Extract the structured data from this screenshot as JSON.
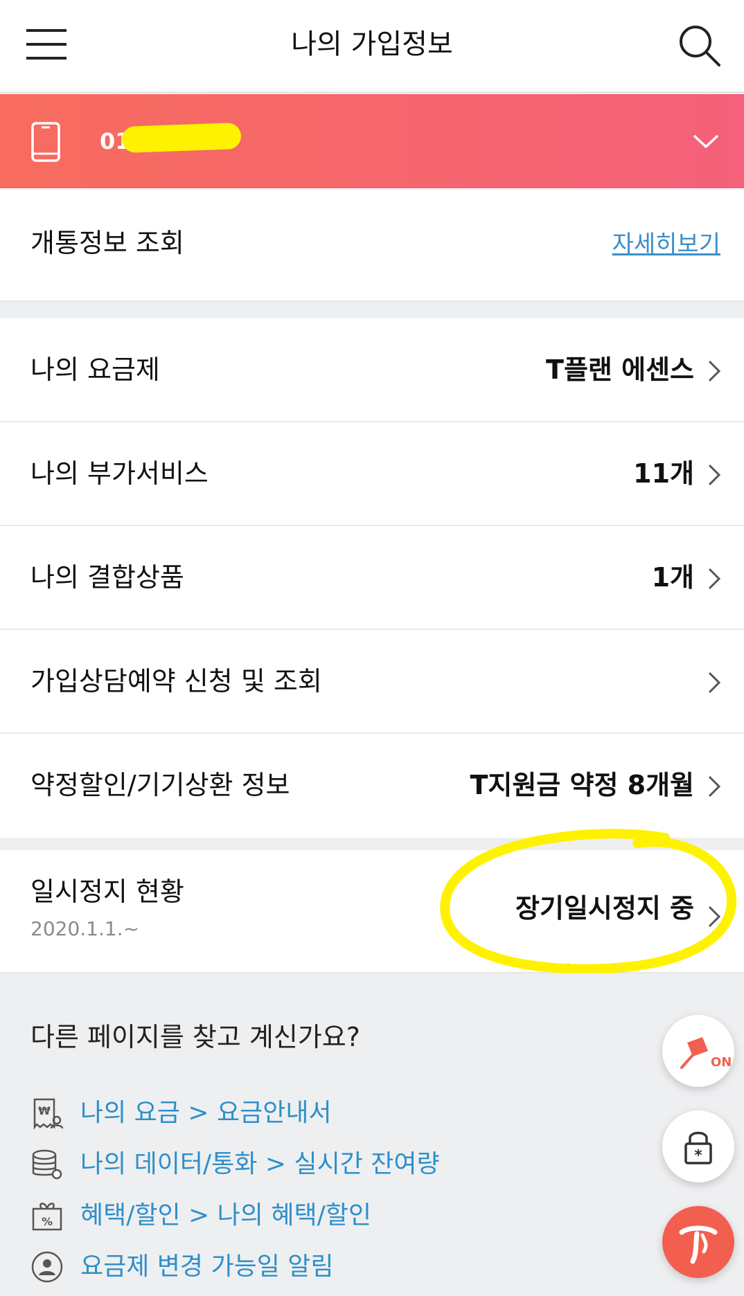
{
  "header": {
    "title": "나의 가입정보"
  },
  "line": {
    "number_prefix": "01"
  },
  "open_info": {
    "label": "개통정보 조회",
    "link": "자세히보기"
  },
  "rows": [
    {
      "label": "나의 요금제",
      "value": "T플랜 에센스"
    },
    {
      "label": "나의 부가서비스",
      "value": "11개"
    },
    {
      "label": "나의 결합상품",
      "value": "1개"
    },
    {
      "label": "가입상담예약 신청 및 조회",
      "value": ""
    },
    {
      "label": "약정할인/기기상환 정보",
      "value": "T지원금 약정 8개월"
    }
  ],
  "pause": {
    "label": "일시정지 현황",
    "date": "2020.1.1.~",
    "value": "장기일시정지 중"
  },
  "other_pages": {
    "title": "다른 페이지를 찾고 계신가요?",
    "links": [
      {
        "text": "나의 요금 > 요금안내서",
        "icon": "bill-icon"
      },
      {
        "text": "나의 데이터/통화 > 실시간 잔여량",
        "icon": "data-icon"
      },
      {
        "text": "혜택/할인 > 나의 혜택/할인",
        "icon": "gift-coupon-icon"
      },
      {
        "text": "요금제 변경 가능일 알림",
        "icon": "user-icon"
      }
    ]
  },
  "floating": {
    "pin_badge": "ON"
  },
  "colors": {
    "banner_start": "#f76c5e",
    "banner_end": "#f5607a",
    "link_blue": "#2e8fc9",
    "highlight_yellow": "#fff200",
    "t_brand": "#f35f4f"
  }
}
